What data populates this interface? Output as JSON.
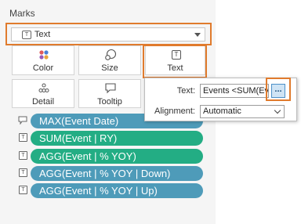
{
  "marks": {
    "title": "Marks",
    "mark_type": "Text",
    "mark_type_icon": "text-box-icon",
    "cards": [
      {
        "label": "Color",
        "icon": "color-dots-icon"
      },
      {
        "label": "Size",
        "icon": "size-icon"
      },
      {
        "label": "Text",
        "icon": "text-box-icon"
      },
      {
        "label": "Detail",
        "icon": "detail-dots-icon"
      },
      {
        "label": "Tooltip",
        "icon": "speech-bubble-icon"
      }
    ],
    "fields": [
      {
        "label": "MAX(Event Date)",
        "icon": "tooltip-icon",
        "color": "#4e9bb9"
      },
      {
        "label": "SUM(Event | RY)",
        "icon": "text-box-icon",
        "color": "#23ad84"
      },
      {
        "label": "AGG(Event | % YOY)",
        "icon": "text-box-icon",
        "color": "#23ad84"
      },
      {
        "label": "AGG(Event | % YOY | Down)",
        "icon": "text-box-icon",
        "color": "#4e9bb9"
      },
      {
        "label": "AGG(Event | % YOY | Up)",
        "icon": "text-box-icon",
        "color": "#4e9bb9"
      }
    ]
  },
  "popup": {
    "text_label": "Text:",
    "text_value": "Events <SUM(Even",
    "more_button": "...",
    "alignment_label": "Alignment:",
    "alignment_value": "Automatic"
  },
  "highlight_color": "#e07b2d"
}
